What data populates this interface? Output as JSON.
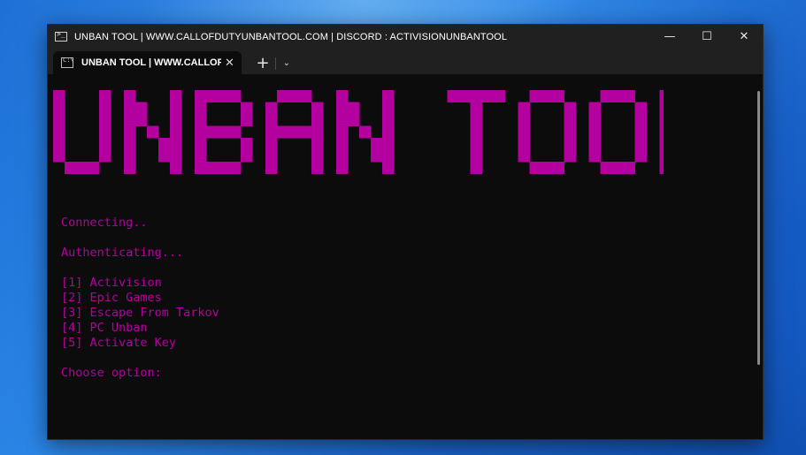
{
  "window": {
    "title": "UNBAN TOOL | WWW.CALLOFDUTYUNBANTOOL.COM | DISCORD : ACTIVISIONUNBANTOOL",
    "controls": {
      "minimize": "—",
      "maximize": "☐",
      "close": "✕"
    }
  },
  "tabs": [
    {
      "label": "UNBAN TOOL | WWW.CALLOF",
      "close": "✕"
    }
  ],
  "tabbar": {
    "new_tab": "+",
    "dropdown": "⌄"
  },
  "terminal": {
    "banner_text": "UNBAN TOOL",
    "text_color": "#b4009e",
    "lines": {
      "connecting": "Connecting..",
      "authenticating": "Authenticating...",
      "option1": "[1] Activision",
      "option2": "[2] Epic Games",
      "option3": "[3] Escape From Tarkov",
      "option4": "[4] PC Unban",
      "option5": "[5] Activate Key",
      "prompt": "Choose option:"
    }
  }
}
